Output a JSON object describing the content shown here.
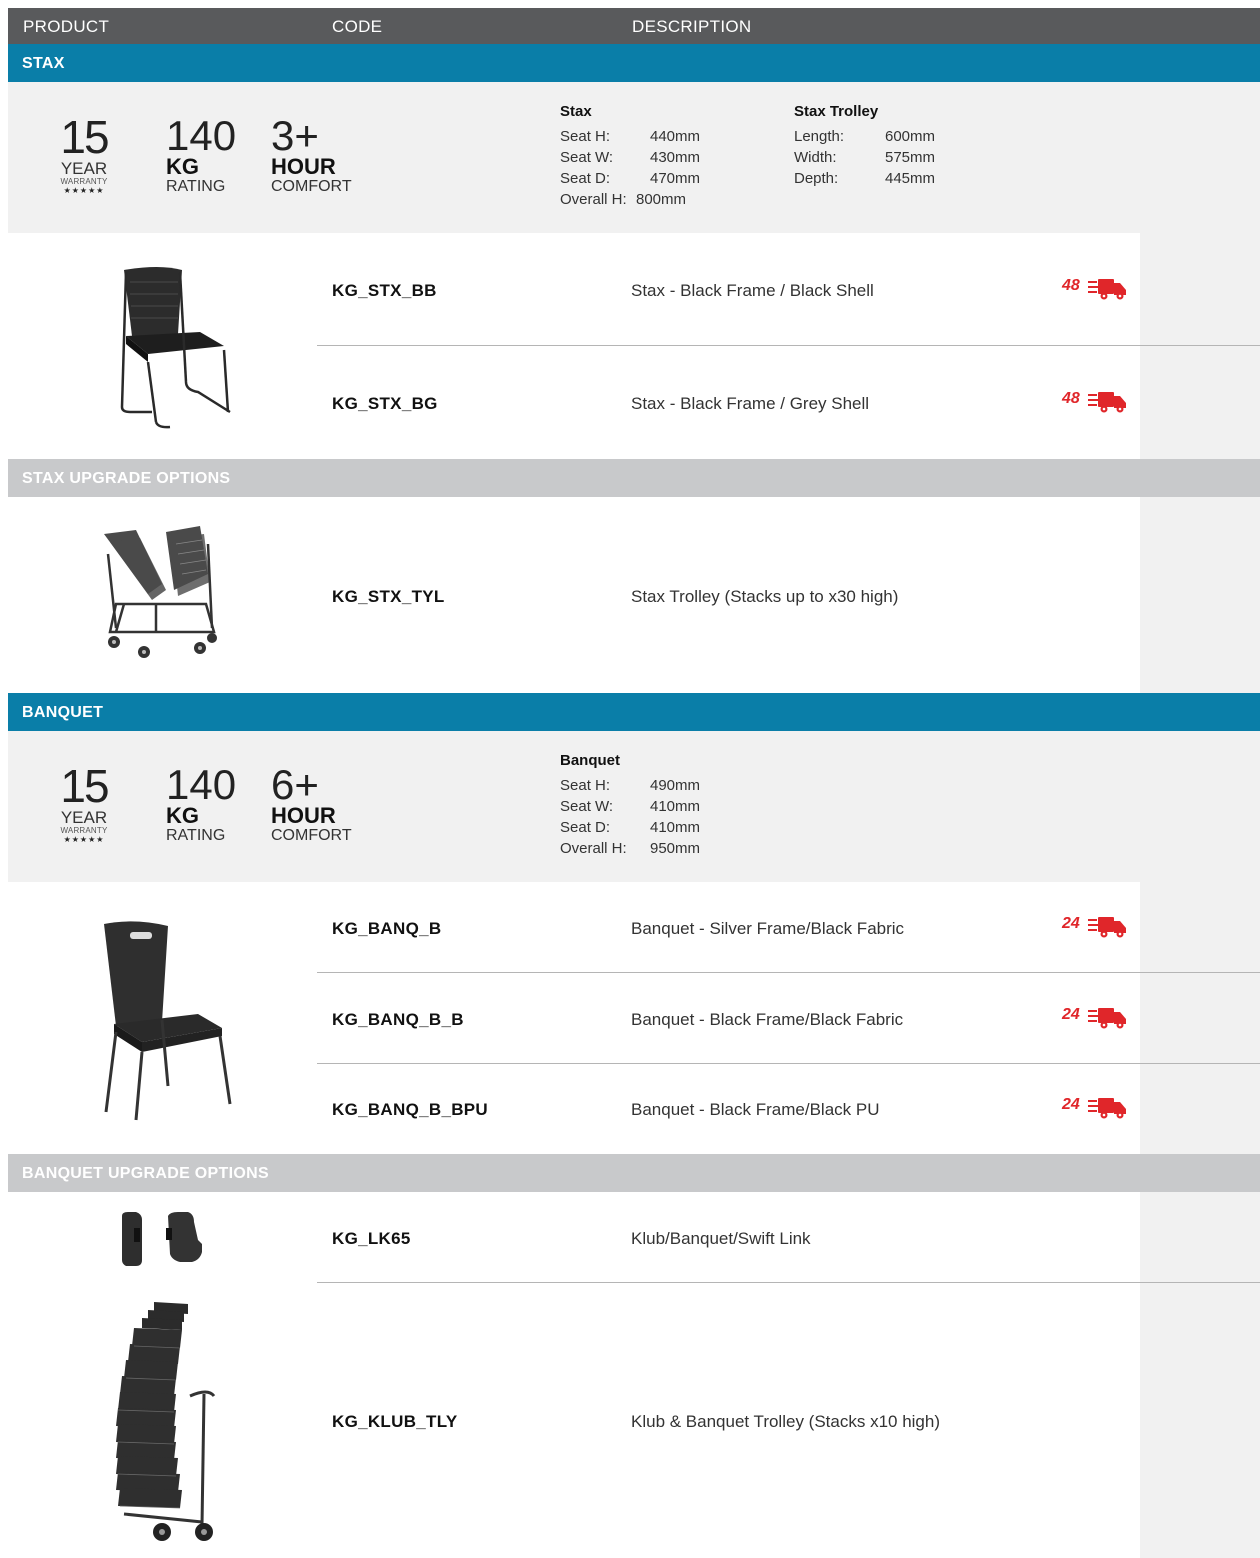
{
  "header": {
    "product": "PRODUCT",
    "code": "CODE",
    "description": "DESCRIPTION"
  },
  "badges": {
    "warranty_years": "15",
    "year": "YEAR",
    "warranty": "WARRANTY",
    "stars": "★★★★★",
    "kg_value": "140",
    "kg": "KG",
    "rating": "RATING",
    "hour": "HOUR",
    "comfort": "COMFORT"
  },
  "sections": {
    "stax": {
      "title": "STAX",
      "hours": "3+",
      "spec1": {
        "title": "Stax",
        "rows": [
          {
            "k": "Seat H:",
            "v": "440mm"
          },
          {
            "k": "Seat W:",
            "v": "430mm"
          },
          {
            "k": "Seat D:",
            "v": "470mm"
          },
          {
            "k": "Overall H:",
            "v": "800mm"
          }
        ]
      },
      "spec2": {
        "title": "Stax Trolley",
        "rows": [
          {
            "k": "Length:",
            "v": "600mm"
          },
          {
            "k": "Width:",
            "v": "575mm"
          },
          {
            "k": "Depth:",
            "v": "445mm"
          }
        ]
      },
      "products": [
        {
          "code": "KG_STX_BB",
          "desc": "Stax - Black Frame / Black Shell",
          "delivery": "48"
        },
        {
          "code": "KG_STX_BG",
          "desc": "Stax - Black Frame / Grey Shell",
          "delivery": "48"
        }
      ]
    },
    "stax_upgrade": {
      "title": "STAX UPGRADE OPTIONS",
      "products": [
        {
          "code": "KG_STX_TYL",
          "desc": "Stax Trolley (Stacks up to x30 high)"
        }
      ]
    },
    "banquet": {
      "title": "BANQUET",
      "hours": "6+",
      "spec1": {
        "title": "Banquet",
        "rows": [
          {
            "k": "Seat H:",
            "v": "490mm"
          },
          {
            "k": "Seat W:",
            "v": "410mm"
          },
          {
            "k": "Seat D:",
            "v": "410mm"
          },
          {
            "k": "Overall H:",
            "v": "950mm"
          }
        ]
      },
      "products": [
        {
          "code": "KG_BANQ_B",
          "desc": "Banquet - Silver Frame/Black Fabric",
          "delivery": "24"
        },
        {
          "code": "KG_BANQ_B_B",
          "desc": "Banquet - Black Frame/Black Fabric",
          "delivery": "24"
        },
        {
          "code": "KG_BANQ_B_BPU",
          "desc": "Banquet - Black Frame/Black PU",
          "delivery": "24"
        }
      ]
    },
    "banquet_upgrade": {
      "title": "BANQUET UPGRADE OPTIONS",
      "products": [
        {
          "code": "KG_LK65",
          "desc": "Klub/Banquet/Swift Link"
        },
        {
          "code": "KG_KLUB_TLY",
          "desc": "Klub & Banquet Trolley (Stacks x10 high)"
        }
      ]
    }
  },
  "colors": {
    "header": "#595a5c",
    "section_blue": "#0a7ea8",
    "section_grey": "#c8c9cb",
    "delivery_red": "#e0262a",
    "panel": "#f1f1f1"
  }
}
